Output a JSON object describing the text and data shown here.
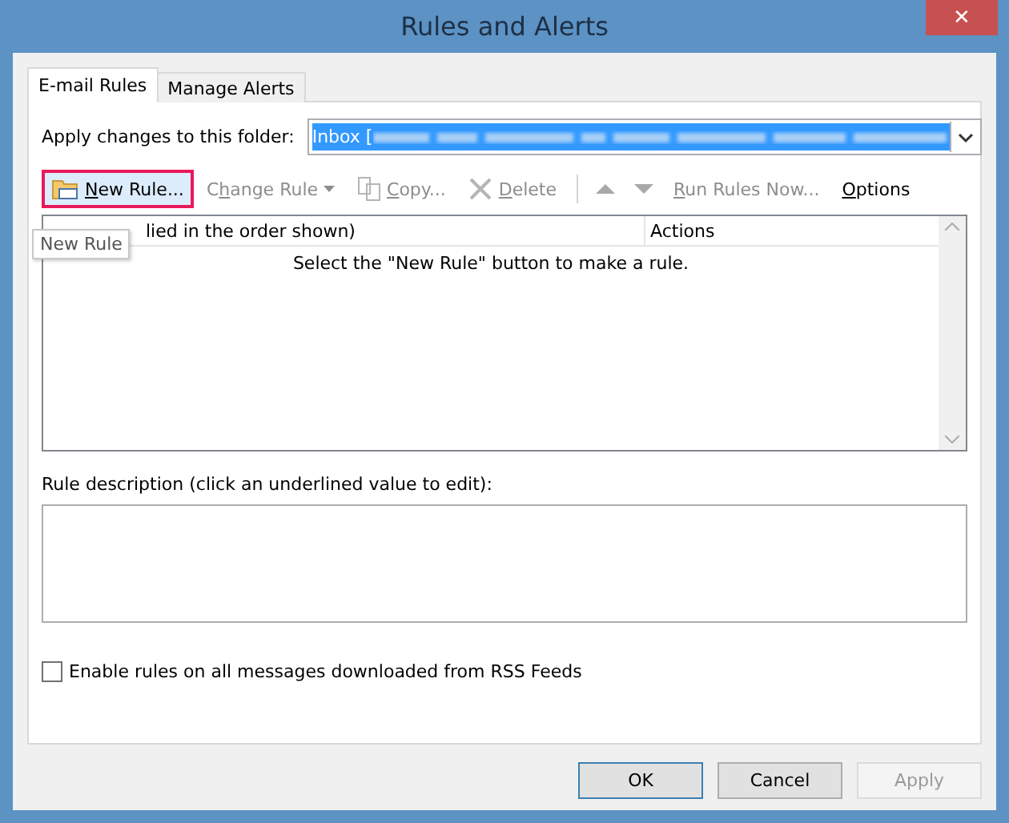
{
  "window": {
    "title": "Rules and Alerts",
    "close": "✕"
  },
  "tabs": [
    {
      "label": "E-mail Rules",
      "selected": true
    },
    {
      "label": "Manage Alerts",
      "selected": false
    }
  ],
  "folder": {
    "label": "Apply changes to this folder:",
    "value": "Inbox ["
  },
  "toolbar": [
    {
      "kind": "new",
      "access_key": "N",
      "label_rest": "ew Rule...",
      "disabled": false,
      "highlighted": true
    },
    {
      "kind": "plain",
      "label_start": "C",
      "access_key": "h",
      "label_rest": "ange Rule",
      "disabled": true,
      "highlighted": false,
      "dropdown": true
    },
    {
      "kind": "copy",
      "access_key": "C",
      "label_rest": "opy...",
      "disabled": true,
      "highlighted": false
    },
    {
      "kind": "delete",
      "access_key": "D",
      "label_rest": "elete",
      "disabled": true,
      "highlighted": false
    },
    {
      "kind": "separator"
    },
    {
      "kind": "up",
      "disabled": true
    },
    {
      "kind": "down",
      "disabled": true
    },
    {
      "kind": "plain",
      "access_key": "R",
      "label_rest": "un Rules Now...",
      "disabled": true,
      "highlighted": false
    },
    {
      "kind": "plain",
      "access_key": "O",
      "label_rest": "ptions",
      "disabled": false,
      "highlighted": false
    }
  ],
  "tooltip": "New Rule",
  "rules_table": {
    "columns": [
      "lied in the order shown)",
      "Actions"
    ],
    "empty_message": "Select the \"New Rule\" button to make a rule."
  },
  "rule_description": {
    "label": "Rule description (click an underlined value to edit):"
  },
  "rss_option": {
    "label": "Enable rules on all messages downloaded from RSS Feeds",
    "checked": false
  },
  "buttons": [
    {
      "label": "OK",
      "default": true,
      "disabled": false
    },
    {
      "label": "Cancel",
      "default": false,
      "disabled": false
    },
    {
      "label": "Apply",
      "default": false,
      "disabled": true
    }
  ]
}
